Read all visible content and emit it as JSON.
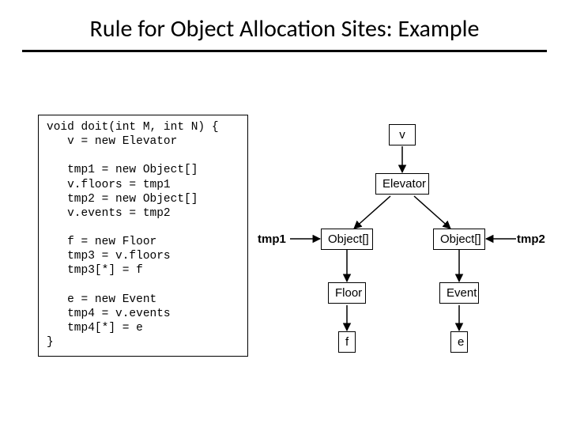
{
  "title": "Rule for Object Allocation Sites: Example",
  "code": "void doit(int M, int N) {\n   v = new Elevator\n\n   tmp1 = new Object[]\n   v.floors = tmp1\n   tmp2 = new Object[]\n   v.events = tmp2\n\n   f = new Floor\n   tmp3 = v.floors\n   tmp3[*] = f\n\n   e = new Event\n   tmp4 = v.events\n   tmp4[*] = e\n}",
  "nodes": {
    "v": "v",
    "elevator": "Elevator",
    "tmp1": "tmp1",
    "obj1": "Object[]",
    "obj2": "Object[]",
    "tmp2": "tmp2",
    "floor": "Floor",
    "event": "Event",
    "f": "f",
    "e": "e"
  }
}
